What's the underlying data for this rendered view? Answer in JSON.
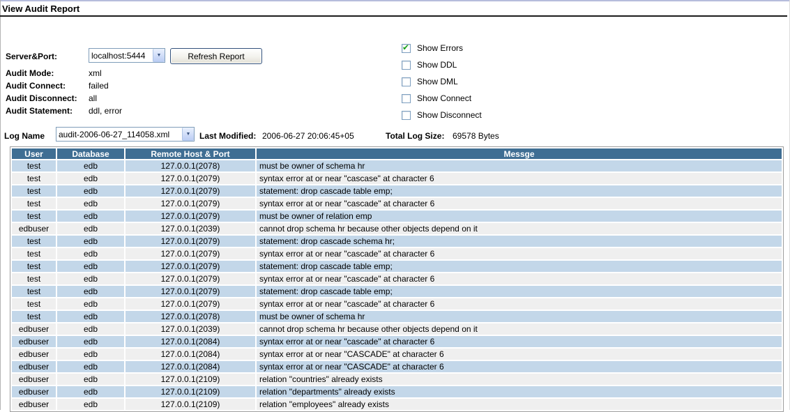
{
  "page": {
    "title": "View Audit Report"
  },
  "colors": {
    "header_bg": "#3f6e93",
    "row_alt_blue": "#c3d7e9",
    "row_alt_gray": "#efefef",
    "control_border": "#7f9db9",
    "check_green": "#1aa11a"
  },
  "form": {
    "server_port": {
      "label": "Server&Port:",
      "value": "localhost:5444"
    },
    "refresh_button": "Refresh Report",
    "fields": [
      {
        "label": "Audit Mode:",
        "value": "xml"
      },
      {
        "label": "Audit Connect:",
        "value": "failed"
      },
      {
        "label": "Audit Disconnect:",
        "value": "all"
      },
      {
        "label": "Audit Statement:",
        "value": "ddl, error"
      }
    ],
    "checkboxes": [
      {
        "label": "Show Errors",
        "checked": true
      },
      {
        "label": "Show DDL",
        "checked": false
      },
      {
        "label": "Show DML",
        "checked": false
      },
      {
        "label": "Show Connect",
        "checked": false
      },
      {
        "label": "Show Disconnect",
        "checked": false
      }
    ]
  },
  "log": {
    "label": "Log Name",
    "selected_file": "audit-2006-06-27_114058.xml",
    "last_modified_label": "Last Modified:",
    "last_modified": "2006-06-27 20:06:45+05",
    "total_size_label": "Total Log Size:",
    "total_size": "69578 Bytes"
  },
  "table": {
    "columns": [
      "User",
      "Database",
      "Remote Host & Port",
      "Messge"
    ],
    "rows": [
      [
        "test",
        "edb",
        "127.0.0.1(2078)",
        "must be owner of schema hr"
      ],
      [
        "test",
        "edb",
        "127.0.0.1(2079)",
        "syntax error at or near \"cascase\" at character 6"
      ],
      [
        "test",
        "edb",
        "127.0.0.1(2079)",
        "statement: drop cascade table emp;"
      ],
      [
        "test",
        "edb",
        "127.0.0.1(2079)",
        "syntax error at or near \"cascade\" at character 6"
      ],
      [
        "test",
        "edb",
        "127.0.0.1(2079)",
        "must be owner of relation emp"
      ],
      [
        "edbuser",
        "edb",
        "127.0.0.1(2039)",
        "cannot drop schema hr because other objects depend on it"
      ],
      [
        "test",
        "edb",
        "127.0.0.1(2079)",
        "statement: drop cascade schema hr;"
      ],
      [
        "test",
        "edb",
        "127.0.0.1(2079)",
        "syntax error at or near \"cascade\" at character 6"
      ],
      [
        "test",
        "edb",
        "127.0.0.1(2079)",
        "statement: drop cascade table emp;"
      ],
      [
        "test",
        "edb",
        "127.0.0.1(2079)",
        "syntax error at or near \"cascade\" at character 6"
      ],
      [
        "test",
        "edb",
        "127.0.0.1(2079)",
        "statement: drop cascade table emp;"
      ],
      [
        "test",
        "edb",
        "127.0.0.1(2079)",
        "syntax error at or near \"cascade\" at character 6"
      ],
      [
        "test",
        "edb",
        "127.0.0.1(2078)",
        "must be owner of schema hr"
      ],
      [
        "edbuser",
        "edb",
        "127.0.0.1(2039)",
        "cannot drop schema hr because other objects depend on it"
      ],
      [
        "edbuser",
        "edb",
        "127.0.0.1(2084)",
        "syntax error at or near \"cascade\" at character 6"
      ],
      [
        "edbuser",
        "edb",
        "127.0.0.1(2084)",
        "syntax error at or near \"CASCADE\" at character 6"
      ],
      [
        "edbuser",
        "edb",
        "127.0.0.1(2084)",
        "syntax error at or near \"CASCADE\" at character 6"
      ],
      [
        "edbuser",
        "edb",
        "127.0.0.1(2109)",
        "relation \"countries\" already exists"
      ],
      [
        "edbuser",
        "edb",
        "127.0.0.1(2109)",
        "relation \"departments\" already exists"
      ],
      [
        "edbuser",
        "edb",
        "127.0.0.1(2109)",
        "relation \"employees\" already exists"
      ]
    ]
  }
}
